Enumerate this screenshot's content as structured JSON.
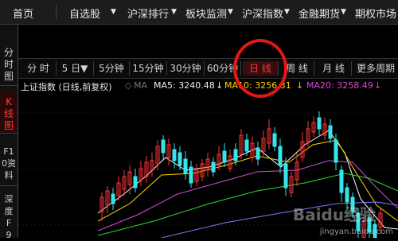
{
  "topnav": [
    "首页",
    "自选股",
    "沪深排行",
    "板块监测",
    "沪深指数",
    "金融期货",
    "期权市场"
  ],
  "sidebar": [
    {
      "label": "分时图",
      "active": false
    },
    {
      "label": "K线图",
      "active": true
    },
    {
      "label": "F10资料",
      "active": false
    },
    {
      "label": "深度F9",
      "active": false
    }
  ],
  "periods": [
    {
      "label": "分 时",
      "active": false
    },
    {
      "label": "5 日▼",
      "active": false
    },
    {
      "label": "5分钟",
      "active": false
    },
    {
      "label": "15分钟",
      "active": false
    },
    {
      "label": "30分钟",
      "active": false
    },
    {
      "label": "60分钟",
      "active": false
    },
    {
      "label": "日 线",
      "active": true
    },
    {
      "label": "周 线",
      "active": false
    },
    {
      "label": "月 线",
      "active": false
    },
    {
      "label": "更多周期",
      "active": false
    }
  ],
  "indicator": {
    "title": "上证指数 (日线,前复权)",
    "ma_label": "MA",
    "ma5": "MA5: 3240.48",
    "ma10": "MA10: 3256.31",
    "ma20": "MA20: 3258.49",
    "arrow": "↓"
  },
  "watermark": {
    "brand": "Baidu经验",
    "url": "jingyan.baidu.com"
  },
  "colors": {
    "up": "#ff3333",
    "down": "#35e5ea",
    "ma5": "#ffffff",
    "ma10": "#ffd400",
    "ma20": "#d44dd4",
    "ma60": "#33d733",
    "ma120": "#7a7aff"
  }
}
